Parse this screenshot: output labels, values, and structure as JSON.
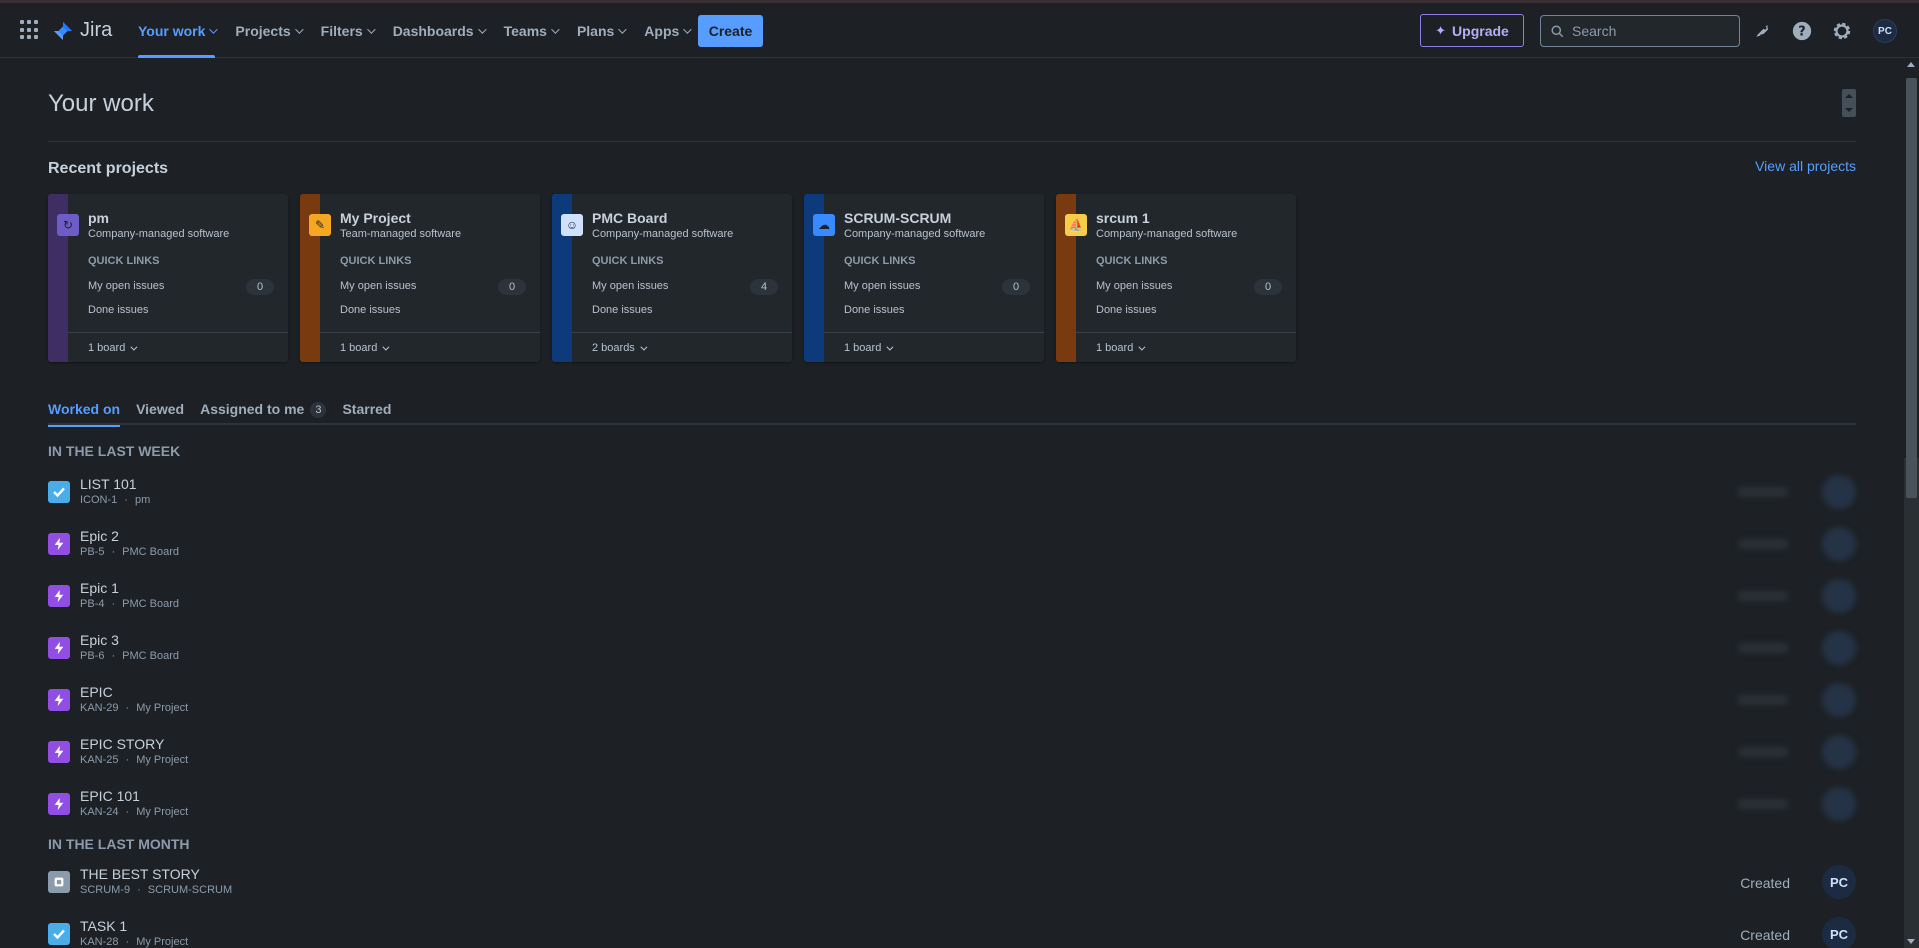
{
  "nav": {
    "logo_text": "Jira",
    "menu": [
      {
        "label": "Your work",
        "active": true
      },
      {
        "label": "Projects",
        "active": false
      },
      {
        "label": "Filters",
        "active": false
      },
      {
        "label": "Dashboards",
        "active": false
      },
      {
        "label": "Teams",
        "active": false
      },
      {
        "label": "Plans",
        "active": false
      },
      {
        "label": "Apps",
        "active": false
      }
    ],
    "create_label": "Create",
    "upgrade_label": "Upgrade",
    "search_placeholder": "Search",
    "avatar_initials": "PC",
    "icons": [
      "app-switcher-icon",
      "notifications-icon",
      "help-icon",
      "settings-icon"
    ]
  },
  "page": {
    "title": "Your work",
    "recent_projects_title": "Recent projects",
    "view_all_label": "View all projects"
  },
  "projects": [
    {
      "name": "pm",
      "type": "Company-managed software",
      "quick_links": "QUICK LINKS",
      "open_label": "My open issues",
      "open_count": "0",
      "done_label": "Done issues",
      "boards": "1 board",
      "stripe": "#3f2e63",
      "icon_bg": "#6e5dc6",
      "icon": "↻"
    },
    {
      "name": "My Project",
      "type": "Team-managed software",
      "quick_links": "QUICK LINKS",
      "open_label": "My open issues",
      "open_count": "0",
      "done_label": "Done issues",
      "boards": "1 board",
      "stripe": "#7a3a10",
      "icon_bg": "#f5a623",
      "icon": "✎"
    },
    {
      "name": "PMC Board",
      "type": "Company-managed software",
      "quick_links": "QUICK LINKS",
      "open_label": "My open issues",
      "open_count": "4",
      "done_label": "Done issues",
      "boards": "2 boards",
      "stripe": "#0c3a7a",
      "icon_bg": "#cfe1fd",
      "icon": "☺"
    },
    {
      "name": "SCRUM-SCRUM",
      "type": "Company-managed software",
      "quick_links": "QUICK LINKS",
      "open_label": "My open issues",
      "open_count": "0",
      "done_label": "Done issues",
      "boards": "1 board",
      "stripe": "#0c3a7a",
      "icon_bg": "#388bff",
      "icon": "☁"
    },
    {
      "name": "srcum 1",
      "type": "Company-managed software",
      "quick_links": "QUICK LINKS",
      "open_label": "My open issues",
      "open_count": "0",
      "done_label": "Done issues",
      "boards": "1 board",
      "stripe": "#7a3a10",
      "icon_bg": "#f5cd47",
      "icon": "⛵"
    }
  ],
  "tabs": [
    {
      "label": "Worked on",
      "active": true,
      "badge": ""
    },
    {
      "label": "Viewed",
      "active": false,
      "badge": ""
    },
    {
      "label": "Assigned to me",
      "active": false,
      "badge": "3"
    },
    {
      "label": "Starred",
      "active": false,
      "badge": ""
    }
  ],
  "groups": [
    {
      "label": "IN THE LAST WEEK"
    },
    {
      "label": "IN THE LAST MONTH"
    }
  ],
  "items": [
    {
      "title": "LIST 101",
      "key": "ICON-1",
      "project": "pm",
      "kind": "task",
      "action": "",
      "avatar": ""
    },
    {
      "title": "Epic 2",
      "key": "PB-5",
      "project": "PMC Board",
      "kind": "epic",
      "action": "",
      "avatar": ""
    },
    {
      "title": "Epic 1",
      "key": "PB-4",
      "project": "PMC Board",
      "kind": "epic",
      "action": "",
      "avatar": ""
    },
    {
      "title": "Epic 3",
      "key": "PB-6",
      "project": "PMC Board",
      "kind": "epic",
      "action": "",
      "avatar": ""
    },
    {
      "title": "EPIC",
      "key": "KAN-29",
      "project": "My Project",
      "kind": "epic",
      "action": "",
      "avatar": ""
    },
    {
      "title": "EPIC STORY",
      "key": "KAN-25",
      "project": "My Project",
      "kind": "epic",
      "action": "",
      "avatar": ""
    },
    {
      "title": "EPIC 101",
      "key": "KAN-24",
      "project": "My Project",
      "kind": "epic",
      "action": "",
      "avatar": ""
    },
    {
      "title": "THE BEST STORY",
      "key": "SCRUM-9",
      "project": "SCRUM-SCRUM",
      "kind": "subtask",
      "action": "Created",
      "avatar": "PC"
    },
    {
      "title": "TASK 1",
      "key": "KAN-28",
      "project": "My Project",
      "kind": "task",
      "action": "Created",
      "avatar": "PC"
    }
  ],
  "separator": "·"
}
